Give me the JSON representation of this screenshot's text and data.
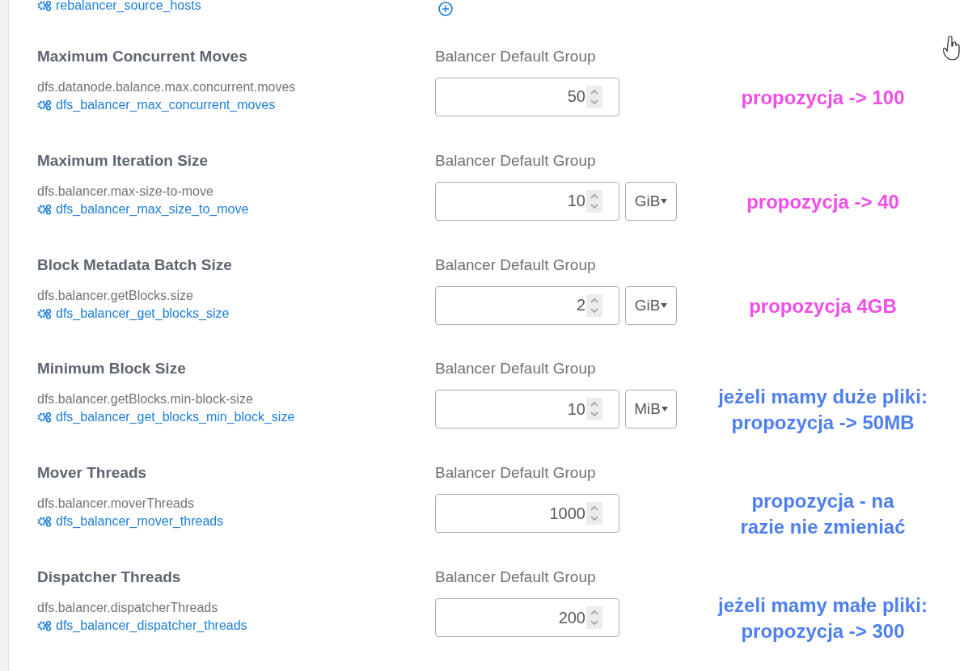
{
  "top_item": {
    "link": "rebalancer_source_hosts"
  },
  "settings": [
    {
      "title": "Maximum Concurrent Moves",
      "property": "dfs.datanode.balance.max.concurrent.moves",
      "link": "dfs_balancer_max_concurrent_moves",
      "group": "Balancer Default Group",
      "value": "50",
      "annotation": {
        "lines": [
          "propozycja -> 100"
        ],
        "color": "#ee4fe6"
      }
    },
    {
      "title": "Maximum Iteration Size",
      "property": "dfs.balancer.max-size-to-move",
      "link": "dfs_balancer_max_size_to_move",
      "group": "Balancer Default Group",
      "value": "10",
      "unit": "GiB",
      "annotation": {
        "lines": [
          "propozycja -> 40"
        ],
        "color": "#ee4fe6"
      }
    },
    {
      "title": "Block Metadata Batch Size",
      "property": "dfs.balancer.getBlocks.size",
      "link": "dfs_balancer_get_blocks_size",
      "group": "Balancer Default Group",
      "value": "2",
      "unit": "GiB",
      "annotation": {
        "lines": [
          "propozycja 4GB"
        ],
        "color": "#ee4fe6"
      }
    },
    {
      "title": "Minimum Block Size",
      "property": "dfs.balancer.getBlocks.min-block-size",
      "link": "dfs_balancer_get_blocks_min_block_size",
      "group": "Balancer Default Group",
      "value": "10",
      "unit": "MiB",
      "annotation": {
        "lines": [
          "jeżeli mamy duże pliki:",
          "propozycja -> 50MB"
        ],
        "color": "#4d7ff0"
      }
    },
    {
      "title": "Mover Threads",
      "property": "dfs.balancer.moverThreads",
      "link": "dfs_balancer_mover_threads",
      "group": "Balancer Default Group",
      "value": "1000",
      "annotation": {
        "lines": [
          "propozycja - na",
          "razie nie zmieniać"
        ],
        "color": "#4d7ff0"
      }
    },
    {
      "title": "Dispatcher Threads",
      "property": "dfs.balancer.dispatcherThreads",
      "link": "dfs_balancer_dispatcher_threads",
      "group": "Balancer Default Group",
      "value": "200",
      "annotation": {
        "lines": [
          "jeżeli mamy małe pliki:",
          "propozycja -> 300"
        ],
        "color": "#4d7ff0"
      }
    }
  ]
}
